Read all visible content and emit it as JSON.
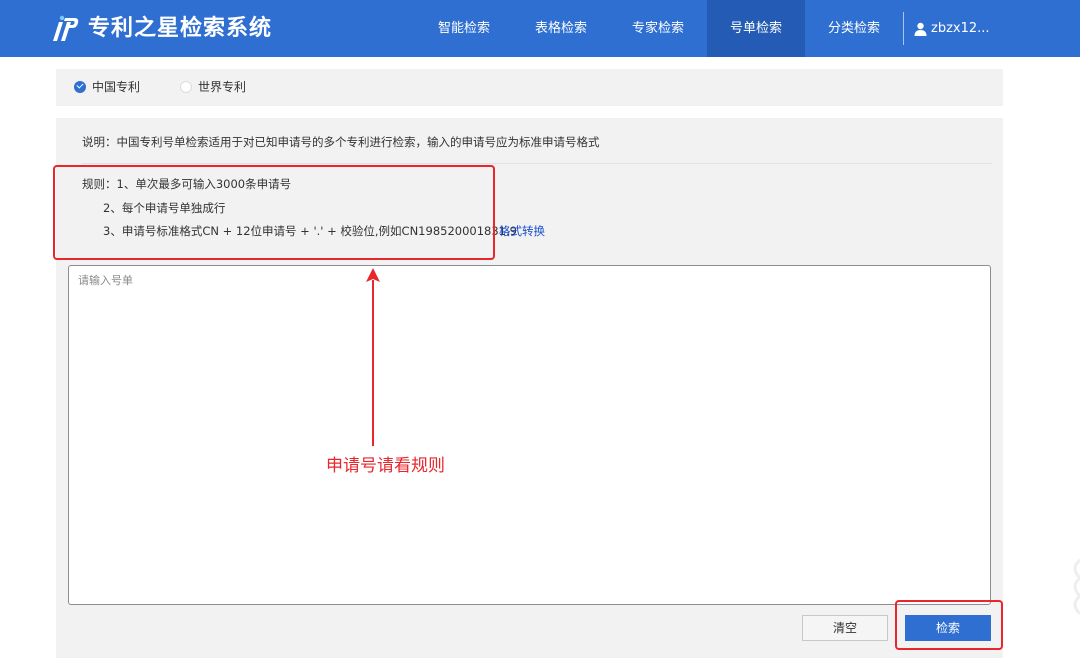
{
  "header": {
    "app_title": "专利之星检索系统",
    "nav": [
      {
        "label": "智能检索",
        "active": false
      },
      {
        "label": "表格检索",
        "active": false
      },
      {
        "label": "专家检索",
        "active": false
      },
      {
        "label": "号单检索",
        "active": true
      },
      {
        "label": "分类检索",
        "active": false
      }
    ],
    "user": "zbzx12...",
    "user_icon": "user-icon"
  },
  "db_selector": {
    "options": [
      {
        "label": "中国专利",
        "selected": true
      },
      {
        "label": "世界专利",
        "selected": false
      }
    ]
  },
  "main": {
    "description": "说明：中国专利号单检索适用于对已知申请号的多个专利进行检索，输入的申请号应为标准申请号格式",
    "rules_prefix": "规则：",
    "rules": [
      "1、单次最多可输入3000条申请号",
      "2、每个申请号单独成行",
      "3、申请号标准格式CN + 12位申请号 + '.' + 校验位,例如CN198520001831.9"
    ],
    "format_link": "格式转换",
    "input_placeholder": "请输入号单",
    "clear_label": "清空",
    "search_label": "检索"
  },
  "annotation": {
    "note": "申请号请看规则",
    "color": "#e8262c"
  },
  "colors": {
    "brand": "#2f6fd1",
    "nav_active": "#245bb5",
    "link": "#1a4fd0"
  }
}
